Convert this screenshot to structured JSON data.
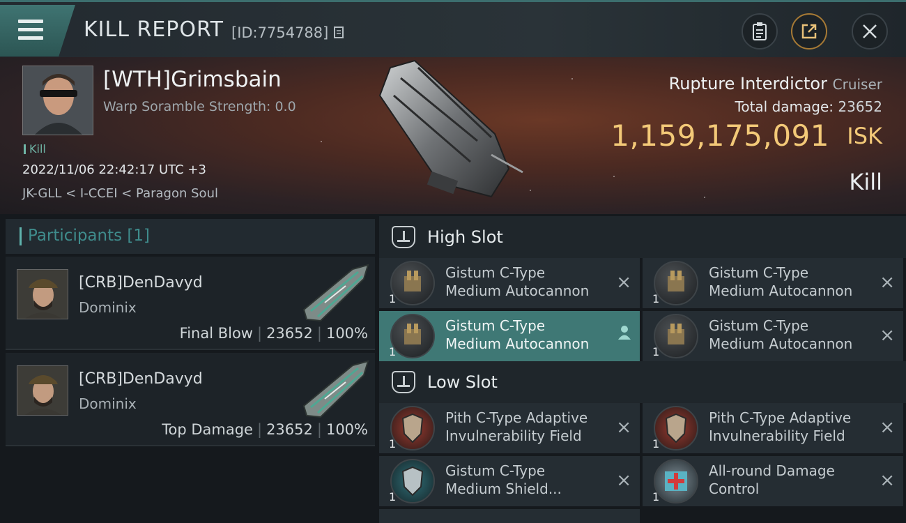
{
  "header": {
    "title": "KILL REPORT",
    "id_label": "[ID:7754788]"
  },
  "victim": {
    "name": "[WTH]Grimsbain",
    "scramble": "Warp Soramble Strength: 0.0",
    "kill_tag": "Kill",
    "datetime": "2022/11/06 22:42:17 UTC +3",
    "location": "JK-GLL < I-CCEI < Paragon Soul",
    "ship_name": "Rupture Interdictor",
    "ship_class": "Cruiser",
    "damage_label": "Total damage:",
    "damage_value": "23652",
    "isk_value": "1,159,175,091",
    "isk_unit": "ISK",
    "result": "Kill"
  },
  "participants": {
    "label": "Participants [1]",
    "items": [
      {
        "name": "[CRB]DenDavyd",
        "ship": "Dominix",
        "role": "Final Blow",
        "damage": "23652",
        "percent": "100%"
      },
      {
        "name": "[CRB]DenDavyd",
        "ship": "Dominix",
        "role": "Top Damage",
        "damage": "23652",
        "percent": "100%"
      }
    ]
  },
  "high_slot": {
    "label": "High Slot",
    "modules": [
      {
        "qty": "1",
        "line1": "Gistum C-Type",
        "line2": "Medium Autocannon"
      },
      {
        "qty": "1",
        "line1": "Gistum C-Type",
        "line2": "Medium Autocannon"
      },
      {
        "qty": "1",
        "line1": "Gistum C-Type",
        "line2": "Medium Autocannon"
      },
      {
        "qty": "1",
        "line1": "Gistum C-Type",
        "line2": "Medium Autocannon"
      }
    ]
  },
  "low_slot": {
    "label": "Low Slot",
    "modules": [
      {
        "qty": "1",
        "line1": "Pith C-Type Adaptive",
        "line2": "Invulnerability Field"
      },
      {
        "qty": "1",
        "line1": "Pith C-Type Adaptive",
        "line2": "Invulnerability Field"
      },
      {
        "qty": "1",
        "line1": "Gistum C-Type",
        "line2": "Medium Shield..."
      },
      {
        "qty": "1",
        "line1": "All-round Damage",
        "line2": "Control"
      }
    ]
  },
  "icons": {
    "close_module": "×",
    "pilot": "person-icon"
  },
  "colors": {
    "accent": "#3f7875",
    "isk": "#f3c978",
    "brand": "#5fb3ad"
  }
}
